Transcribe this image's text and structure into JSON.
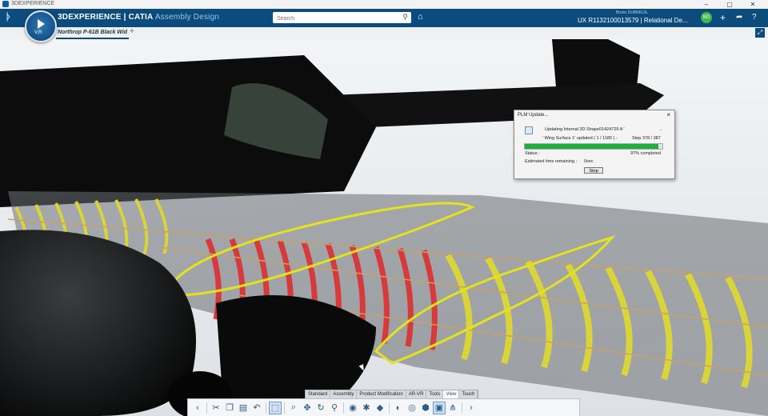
{
  "window": {
    "app_title": "3DEXPERIENCE",
    "minimize": "–",
    "maximize": "▢",
    "close": "✕"
  },
  "topbar": {
    "compass_label": "V,R",
    "brand_prefix": "3D",
    "brand_main": "EXPERIENCE | CATIA",
    "app_name": "Assembly Design",
    "search_placeholder": "Search",
    "user_name": "Bruno DUBREUIL",
    "context": "UX R1132100013579 | Relational De...",
    "avatar_initials": "BD",
    "colors": {
      "bar": "#0c4b7d",
      "accent": "#42b649"
    }
  },
  "document_tab": {
    "label": "Northrop P-61B Black Wid",
    "add_label": "+"
  },
  "dialog": {
    "title": "PLM Update...",
    "line1": "Updating Internal 3D Shape01424729 A '",
    "line1_suffix": "...",
    "line2": "' Wing Surface 1' updated ( 1 / 1180 )   -",
    "line2_step": "Step 378 / 387",
    "progress": 0.97,
    "status_label": "Status :",
    "status_value": "97% completed",
    "time_label": "Estimated time remaining :",
    "time_value": "0sec",
    "stop_label": "Stop"
  },
  "app_tabs": [
    "Standard",
    "Assembly",
    "Product Modification",
    "AR-VR",
    "Tools",
    "View",
    "Touch"
  ],
  "active_app_tab": "View",
  "action_icons": [
    "chevron-icon",
    "cut-icon",
    "copy-icon",
    "paste-icon",
    "undo-icon",
    "select-icon",
    "zoom-icon",
    "pan-icon",
    "rotate-icon",
    "search-zoom-icon",
    "capture-icon",
    "render-icon",
    "cube-icon",
    "shading-icon",
    "hide-show-icon",
    "material-icon",
    "section-icon",
    "tree-icon",
    "more-icon"
  ]
}
